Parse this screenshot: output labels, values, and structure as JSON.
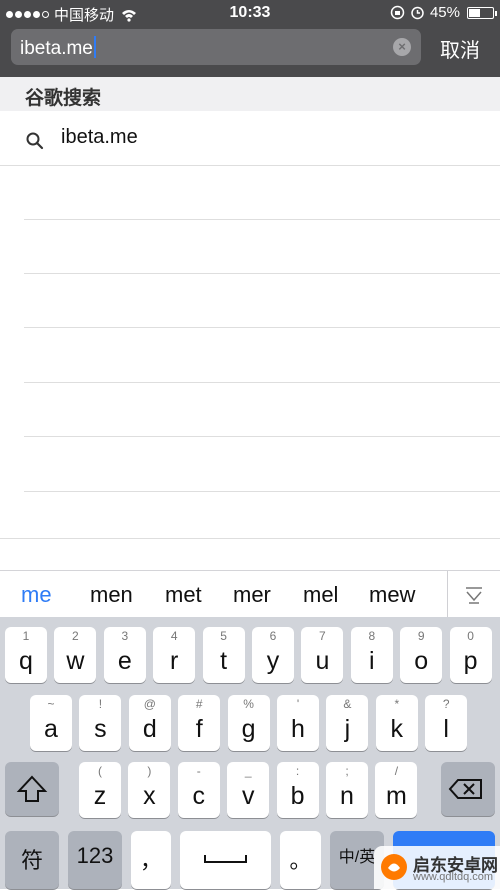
{
  "status_bar": {
    "carrier": "中国移动",
    "time": "10:33",
    "battery": "45%",
    "battery_level": 0.45,
    "icons": [
      "signal-dots",
      "wifi-icon",
      "rotation-lock-icon",
      "alarm-icon",
      "battery-icon"
    ]
  },
  "search": {
    "value": "ibeta.me",
    "clear_icon": "clear-icon",
    "cancel_label": "取消"
  },
  "section": {
    "title": "谷歌搜索"
  },
  "results": [
    {
      "icon": "search-icon",
      "text": "ibeta.me"
    }
  ],
  "suggestions": [
    "me",
    "men",
    "met",
    "mer",
    "mel",
    "mew"
  ],
  "keyboard": {
    "row1": [
      {
        "main": "q",
        "secondary": "1"
      },
      {
        "main": "w",
        "secondary": "2"
      },
      {
        "main": "e",
        "secondary": "3"
      },
      {
        "main": "r",
        "secondary": "4"
      },
      {
        "main": "t",
        "secondary": "5"
      },
      {
        "main": "y",
        "secondary": "6"
      },
      {
        "main": "u",
        "secondary": "7"
      },
      {
        "main": "i",
        "secondary": "8"
      },
      {
        "main": "o",
        "secondary": "9"
      },
      {
        "main": "p",
        "secondary": "0"
      }
    ],
    "row2": [
      {
        "main": "a",
        "secondary": "~"
      },
      {
        "main": "s",
        "secondary": "!"
      },
      {
        "main": "d",
        "secondary": "@"
      },
      {
        "main": "f",
        "secondary": "#"
      },
      {
        "main": "g",
        "secondary": "%"
      },
      {
        "main": "h",
        "secondary": "'"
      },
      {
        "main": "j",
        "secondary": "&"
      },
      {
        "main": "k",
        "secondary": "*"
      },
      {
        "main": "l",
        "secondary": "?"
      }
    ],
    "row3": [
      {
        "main": "z",
        "secondary": "("
      },
      {
        "main": "x",
        "secondary": ")"
      },
      {
        "main": "c",
        "secondary": "-"
      },
      {
        "main": "v",
        "secondary": "_"
      },
      {
        "main": "b",
        "secondary": ":"
      },
      {
        "main": "n",
        "secondary": ";"
      },
      {
        "main": "m",
        "secondary": "/"
      }
    ],
    "bottom": {
      "symbols": "符",
      "numbers": "123",
      "comma": "，",
      "period": "。",
      "lang": "中/英"
    }
  },
  "watermark": {
    "title": "启东安卓网",
    "url": "www.qdltdq.com"
  },
  "colors": {
    "header": "#4a4a4c",
    "accent": "#2f7cf6",
    "keyboard": "#d1d4da"
  }
}
